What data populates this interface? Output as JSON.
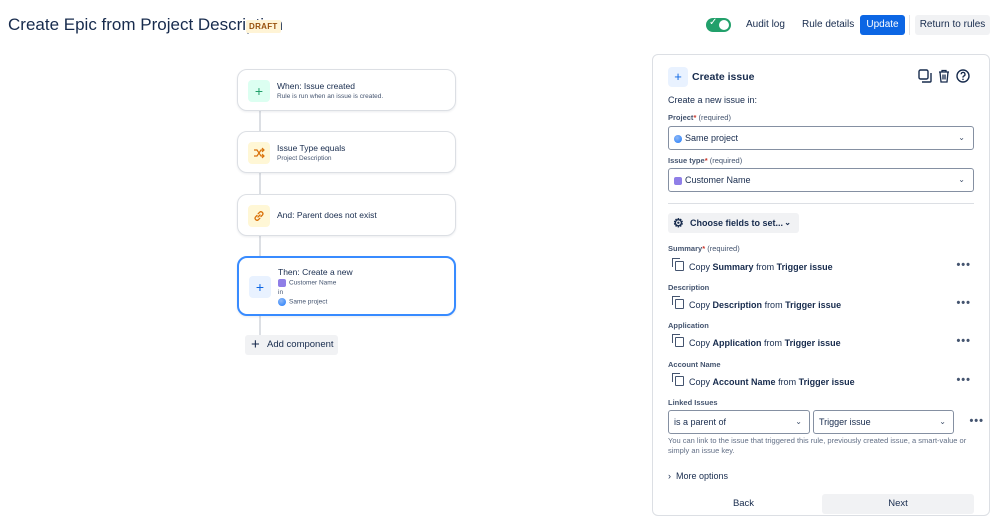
{
  "header": {
    "title": "Create Epic from Project Description",
    "badge": "DRAFT",
    "audit_log": "Audit log",
    "rule_details": "Rule details",
    "update": "Update",
    "return_to_rules": "Return to rules",
    "toggle_enabled": true
  },
  "flow": {
    "nodes": [
      {
        "title": "When: Issue created",
        "subtitle": "Rule is run when an issue is created.",
        "icon": "plus-icon"
      },
      {
        "title": "Issue Type equals",
        "subtitle": "Project Description",
        "icon": "shuffle-icon"
      },
      {
        "title": "And: Parent does not exist",
        "icon": "link-icon"
      },
      {
        "title": "Then: Create a new",
        "issue_type": "Customer Name",
        "in": "in",
        "project": "Same project",
        "icon": "plus-icon"
      }
    ],
    "add_component": "Add component"
  },
  "panel": {
    "title": "Create issue",
    "subtitle": "Create a new issue in:",
    "project_label": "Project",
    "issue_type_label": "Issue type",
    "required": "(required)",
    "project_value": "Same project",
    "issue_type_value": "Customer Name",
    "choose_fields": "Choose fields to set...",
    "fields": [
      {
        "label": "Summary",
        "required": true,
        "copy": "Copy",
        "field": "Summary",
        "from": "from",
        "source": "Trigger issue"
      },
      {
        "label": "Description",
        "copy": "Copy",
        "field": "Description",
        "from": "from",
        "source": "Trigger issue"
      },
      {
        "label": "Application",
        "copy": "Copy",
        "field": "Application",
        "from": "from",
        "source": "Trigger issue"
      },
      {
        "label": "Account Name",
        "copy": "Copy",
        "field": "Account Name",
        "from": "from",
        "source": "Trigger issue"
      }
    ],
    "linked_issues_label": "Linked Issues",
    "link_type": "is a parent of",
    "link_target": "Trigger issue",
    "help_text": "You can link to the issue that triggered this rule, previously created issue, a smart-value or simply an issue key.",
    "more_options": "More options",
    "back": "Back",
    "next": "Next"
  }
}
